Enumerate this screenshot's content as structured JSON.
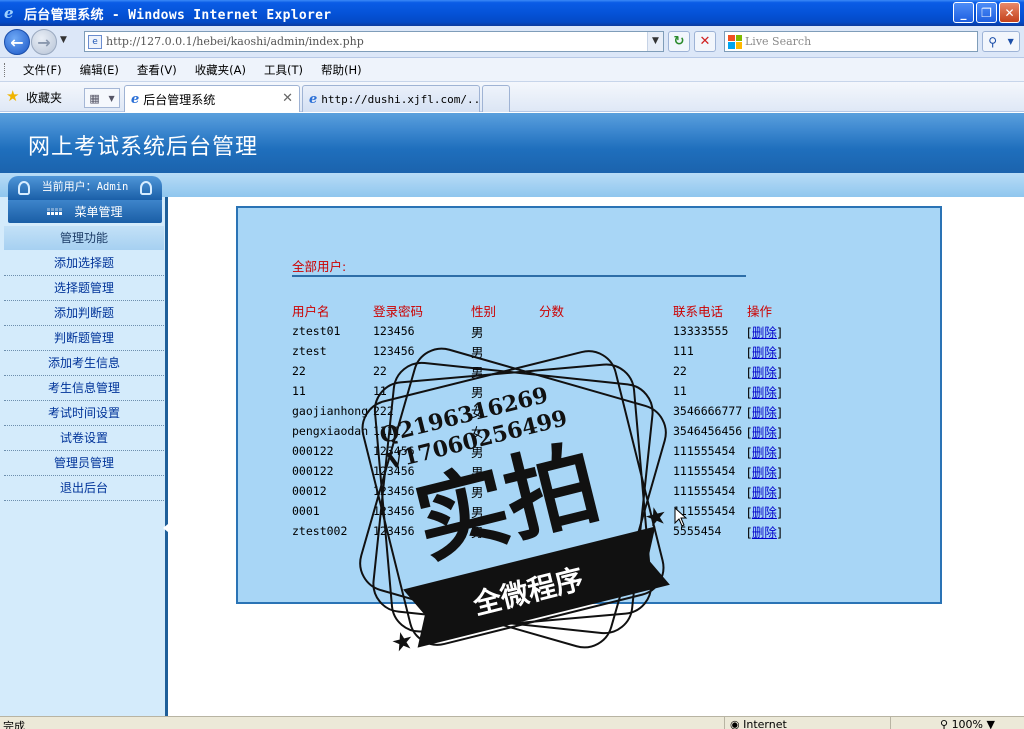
{
  "window": {
    "title": "后台管理系统 - Windows Internet Explorer",
    "minimize": "_",
    "maximize": "❐",
    "close": "✕"
  },
  "address": {
    "url": "http://127.0.0.1/hebei/kaoshi/admin/index.php",
    "search_placeholder": "Live Search"
  },
  "menubar": [
    "文件(F)",
    "编辑(E)",
    "查看(V)",
    "收藏夹(A)",
    "工具(T)",
    "帮助(H)"
  ],
  "favorites": {
    "label": "收藏夹"
  },
  "tabs": [
    {
      "label": "后台管理系统",
      "active": true
    },
    {
      "label": "http://dushi.xjfl.com/...",
      "active": false
    }
  ],
  "page": {
    "site_title": "网上考试系统后台管理",
    "current_user_label": "当前用户：",
    "current_user": "Admin",
    "menu_header": "菜单管理",
    "section": "管理功能",
    "links": [
      "添加选择题",
      "选择题管理",
      "添加判断题",
      "判断题管理",
      "添加考生信息",
      "考生信息管理",
      "考试时间设置",
      "试卷设置",
      "管理员管理",
      "退出后台"
    ]
  },
  "users": {
    "heading": "全部用户:",
    "columns": [
      "用户名",
      "登录密码",
      "性别",
      "分数",
      "联系电话",
      "操作"
    ],
    "delete_label": "删除",
    "rows": [
      {
        "username": "ztest01",
        "password": "123456",
        "sex": "男",
        "score": "",
        "phone": "13333555"
      },
      {
        "username": "ztest",
        "password": "123456",
        "sex": "男",
        "score": "",
        "phone": "111"
      },
      {
        "username": "22",
        "password": "22",
        "sex": "男",
        "score": "",
        "phone": "22"
      },
      {
        "username": "11",
        "password": "11",
        "sex": "男",
        "score": "",
        "phone": "11"
      },
      {
        "username": "gaojianhong",
        "password": "222",
        "sex": "女",
        "score": "",
        "phone": "3546666777"
      },
      {
        "username": "pengxiaodan",
        "password": "1111",
        "sex": "女",
        "score": "",
        "phone": "3546456456"
      },
      {
        "username": "000122",
        "password": "123456",
        "sex": "男",
        "score": "",
        "phone": "111555454"
      },
      {
        "username": "000122",
        "password": "123456",
        "sex": "男",
        "score": "",
        "phone": "111555454"
      },
      {
        "username": "00012",
        "password": "123456",
        "sex": "男",
        "score": "",
        "phone": "111555454"
      },
      {
        "username": "0001",
        "password": "123456",
        "sex": "男",
        "score": "",
        "phone": "111555454"
      },
      {
        "username": "ztest002",
        "password": "123456",
        "sex": "男",
        "score": "",
        "phone": "5555454"
      }
    ]
  },
  "watermark": {
    "line1": "Q2196316269",
    "line2": "V17060256499",
    "main": "实拍",
    "ribbon": "全微程序"
  },
  "status": {
    "text": "完成",
    "zone": "Internet",
    "zoom": "100%"
  }
}
